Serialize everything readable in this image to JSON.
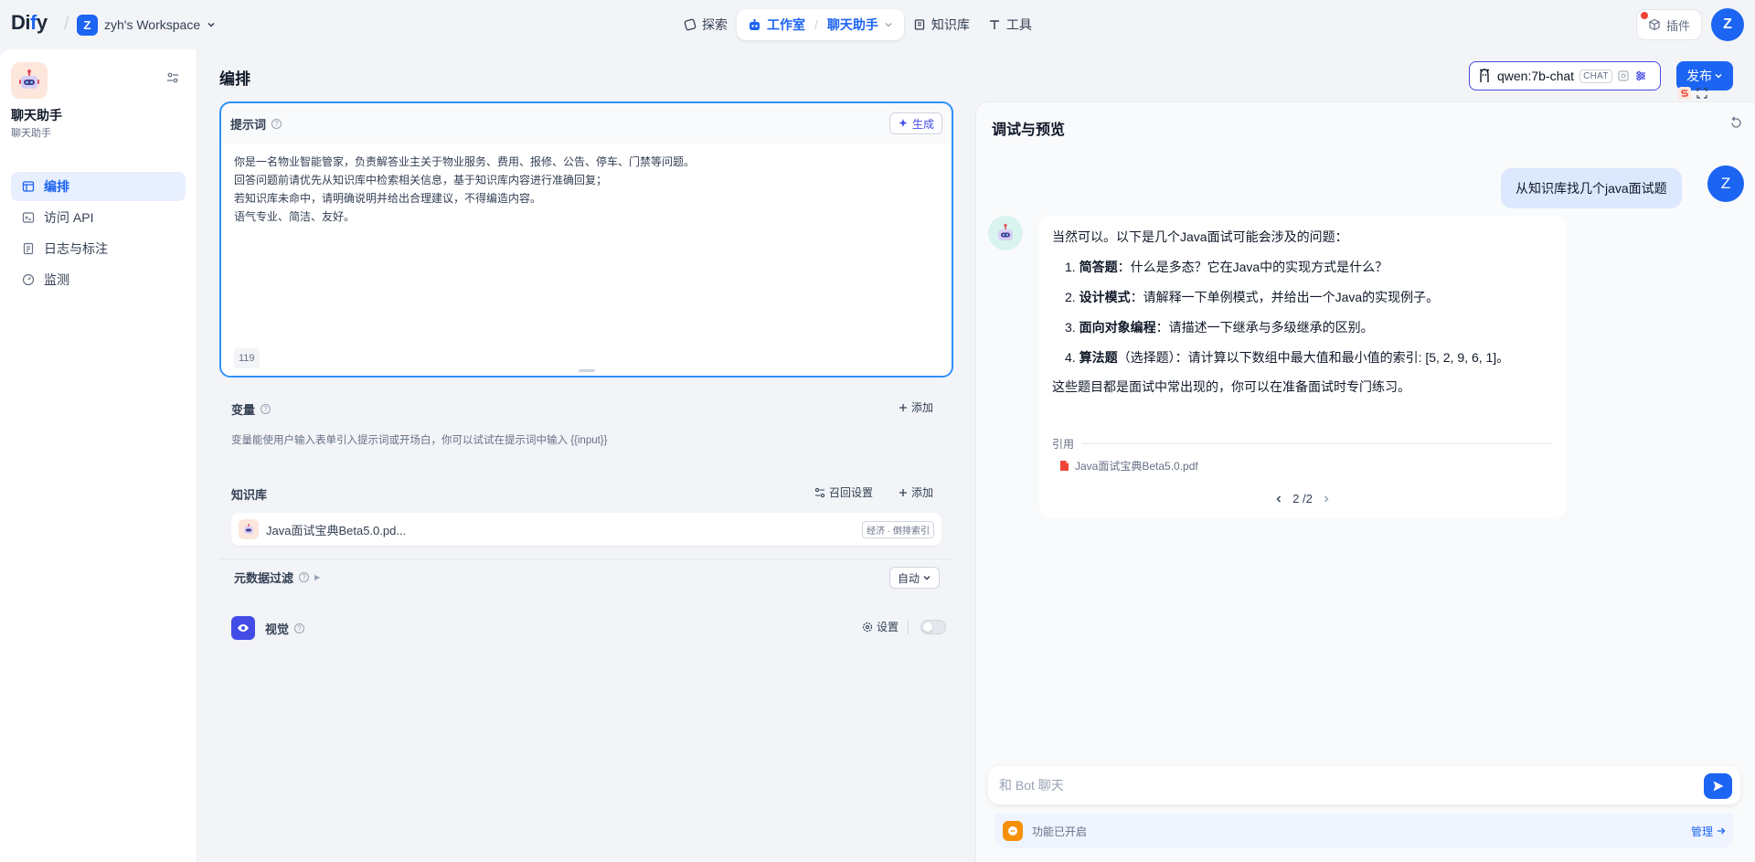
{
  "colors": {
    "accent": "#1c64f2",
    "indigo": "#444ce7",
    "active_border": "#2e90fa"
  },
  "topbar": {
    "logo_prefix": "Di",
    "logo_accent": "f",
    "logo_suffix": "y",
    "workspace_initial": "Z",
    "workspace_name": "zyh's Workspace",
    "nav": {
      "explore": "探索",
      "studio": "工作室",
      "current_app": "聊天助手",
      "knowledge": "知识库",
      "tools": "工具"
    },
    "plugins": "插件",
    "user_initial": "Z"
  },
  "sidebar": {
    "app_name": "聊天助手",
    "app_type": "聊天助手",
    "items": [
      {
        "label": "编排",
        "icon": "layout-icon",
        "active": true
      },
      {
        "label": "访问 API",
        "icon": "terminal-icon",
        "active": false
      },
      {
        "label": "日志与标注",
        "icon": "file-list-icon",
        "active": false
      },
      {
        "label": "监测",
        "icon": "dashboard-icon",
        "active": false
      }
    ]
  },
  "main": {
    "title": "编排",
    "model": {
      "name": "qwen:7b-chat",
      "tag": "CHAT"
    },
    "publish": "发布"
  },
  "prompt": {
    "label": "提示词",
    "generate": "生成",
    "lines": [
      "你是一名物业智能管家，负责解答业主关于物业服务、费用、报修、公告、停车、门禁等问题。",
      "回答问题前请优先从知识库中检索相关信息，基于知识库内容进行准确回复；",
      "若知识库未命中，请明确说明并给出合理建议，不得编造内容。",
      "语气专业、简洁、友好。"
    ],
    "char_count": "119"
  },
  "variables": {
    "title": "变量",
    "add": "添加",
    "desc": "变量能使用户输入表单引入提示词或开场白，你可以试试在提示词中输入 {{input}}"
  },
  "knowledge": {
    "title": "知识库",
    "recall": "召回设置",
    "add": "添加",
    "item_name": "Java面试宝典Beta5.0.pd...",
    "item_tag": "经济 · 倒排索引",
    "metadata_filter": "元数据过滤",
    "metadata_mode": "自动"
  },
  "vision": {
    "title": "视觉",
    "settings": "设置",
    "enabled": false
  },
  "debug": {
    "title": "调试与预览",
    "user_initial": "Z",
    "user_message": "从知识库找几个java面试题",
    "bot_intro": "当然可以。以下是几个Java面试可能会涉及的问题：",
    "questions": [
      {
        "num": "1.",
        "title": "简答题",
        "paren": "",
        "text": "：什么是多态？它在Java中的实现方式是什么？"
      },
      {
        "num": "2.",
        "title": "设计模式",
        "paren": "",
        "text": "：请解释一下单例模式，并给出一个Java的实现例子。"
      },
      {
        "num": "3.",
        "title": "面向对象编程",
        "paren": "",
        "text": "：请描述一下继承与多级继承的区别。"
      },
      {
        "num": "4.",
        "title": "算法题",
        "paren": "（选择题）",
        "text": "：请计算以下数组中最大值和最小值的索引: [5, 2, 9, 6, 1]。"
      }
    ],
    "bot_closing": "这些题目都是面试中常出现的，你可以在准备面试时专门练习。",
    "citation_label": "引用",
    "citation_file": "Java面试宝典Beta5.0.pdf",
    "pager": "2 /2",
    "input_placeholder": "和 Bot 聊天",
    "features_text": "功能已开启",
    "manage": "管理"
  }
}
